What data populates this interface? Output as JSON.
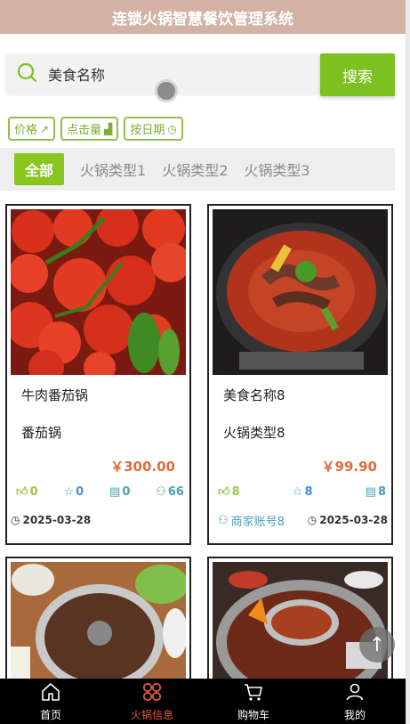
{
  "header": {
    "title": "连锁火锅智慧餐饮管理系统"
  },
  "search": {
    "placeholder": "美食名称",
    "button": "搜索"
  },
  "sort": [
    {
      "label": "价格",
      "icon": "trend-icon"
    },
    {
      "label": "点击量",
      "icon": "bar-chart-icon"
    },
    {
      "label": "按日期",
      "icon": "clock-icon"
    }
  ],
  "tabs": [
    "全部",
    "火锅类型1",
    "火锅类型2",
    "火锅类型3"
  ],
  "cards": [
    {
      "name": "牛肉番茄锅",
      "type": "番茄锅",
      "price": "￥300.00",
      "likes": "0",
      "favorites": "0",
      "views": "0",
      "clicks": "66",
      "date": "2025-03-28"
    },
    {
      "name": "美食名称8",
      "type": "火锅类型8",
      "price": "￥99.90",
      "likes": "8",
      "favorites": "8",
      "views": "8",
      "merchant": "商家账号8",
      "date": "2025-03-28"
    }
  ],
  "nav": [
    {
      "label": "首页",
      "icon": "home-icon"
    },
    {
      "label": "火锅信息",
      "icon": "grid-icon"
    },
    {
      "label": "购物车",
      "icon": "cart-icon"
    },
    {
      "label": "我的",
      "icon": "user-icon"
    }
  ],
  "colors": {
    "accent": "#7cc11f",
    "header": "#d3b2a4",
    "price": "#e06c3a",
    "nav_active": "#e05a3a"
  }
}
